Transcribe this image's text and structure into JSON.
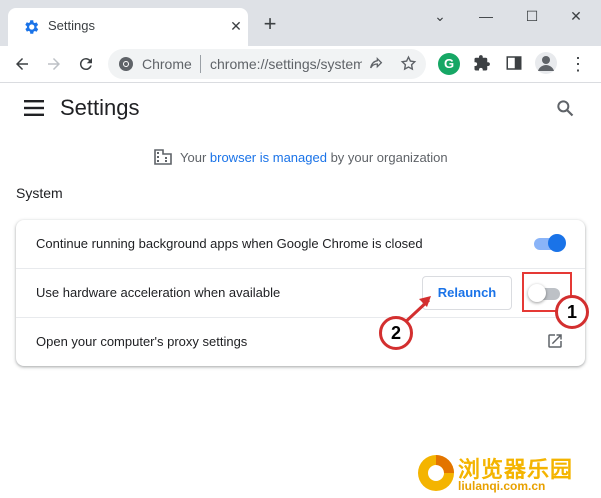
{
  "tab": {
    "title": "Settings"
  },
  "toolbar": {
    "site": "Chrome",
    "url": "chrome://settings/system"
  },
  "page": {
    "title": "Settings",
    "managed_prefix": "Your ",
    "managed_link": "browser is managed",
    "managed_suffix": " by your organization",
    "section": "System"
  },
  "settings": [
    {
      "label": "Continue running background apps when Google Chrome is closed",
      "toggle": true
    },
    {
      "label": "Use hardware acceleration when available",
      "toggle": false,
      "button": "Relaunch"
    },
    {
      "label": "Open your computer's proxy settings"
    }
  ],
  "annotations": {
    "callout1": "1",
    "callout2": "2"
  },
  "watermark": {
    "cn": "浏览器乐园",
    "en": "liulanqi.com.cn"
  },
  "colors": {
    "accent": "#1a73e8",
    "annotation": "#d32f2f",
    "watermark": "#f4b400"
  }
}
